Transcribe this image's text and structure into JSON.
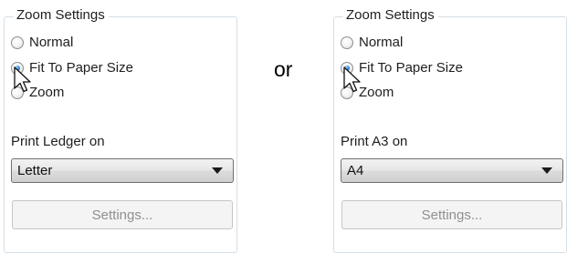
{
  "separator": "or",
  "panels": [
    {
      "group_title": "Zoom Settings",
      "radios": [
        {
          "label": "Normal",
          "checked": false
        },
        {
          "label": "Fit To Paper Size",
          "checked": true
        },
        {
          "label": "Zoom",
          "checked": false
        }
      ],
      "print_label": "Print Ledger on",
      "paper_select": {
        "value": "Letter"
      },
      "settings_button": "Settings..."
    },
    {
      "group_title": "Zoom Settings",
      "radios": [
        {
          "label": "Normal",
          "checked": false
        },
        {
          "label": "Fit To Paper Size",
          "checked": true
        },
        {
          "label": "Zoom",
          "checked": false
        }
      ],
      "print_label": "Print A3 on",
      "paper_select": {
        "value": "A4"
      },
      "settings_button": "Settings..."
    }
  ],
  "colors": {
    "radio_checked": "#2f86d6",
    "disabled_text": "#8f8f8f",
    "group_border": "#d5dfe5"
  },
  "icons": {
    "cursor": "arrow-pointer-icon",
    "dropdown": "chevron-down-icon"
  }
}
